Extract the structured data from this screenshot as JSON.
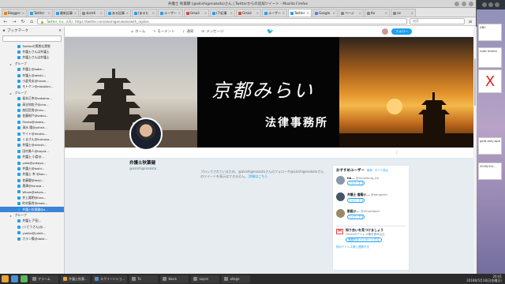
{
  "window": {
    "title": "弁護士 秋葉健 (@akishigenakoto)さん | Twitterからの追加ツイート - Mozilla Firefox"
  },
  "tabs": [
    {
      "label": "Blogger: ",
      "color": "#f57c00"
    },
    {
      "label": "Twitter",
      "color": "#1da1f2"
    },
    {
      "label": "最新記事",
      "color": "#1da1f2"
    },
    {
      "label": "本のHi",
      "color": "#888888"
    },
    {
      "label": "ある記事",
      "color": "#1da1f2"
    },
    {
      "label": "(あるた",
      "color": "#1da1f2"
    },
    {
      "label": "ユーザー",
      "color": "#1da1f2"
    },
    {
      "label": "Gmail",
      "color": "#d44638"
    },
    {
      "label": "(7)記事",
      "color": "#1da1f2"
    },
    {
      "label": "Gmail",
      "color": "#d44638"
    },
    {
      "label": "ユーザー",
      "color": "#1da1f2"
    },
    {
      "label": "Twitter",
      "color": "#1da1f2"
    },
    {
      "label": "Google",
      "color": "#4285f4"
    },
    {
      "label": "ページ",
      "color": "#888888"
    },
    {
      "label": "Ito",
      "color": "#888888"
    },
    {
      "label": "ne",
      "color": "#888888"
    }
  ],
  "navbar": {
    "back": "←",
    "forward": "→",
    "reload": "↻",
    "home": "⌂",
    "secure_label": "Twitter, Inc. (US)",
    "url": "https://twitter.com/akishigenakoto/with_replies",
    "search_placeholder": "検索"
  },
  "sidebar": {
    "title": "ブックマーク",
    "items": [
      {
        "label": "Twitterの実態な実態",
        "type": "bm",
        "indent": 14
      },
      {
        "label": "弁護士さんは弁護士",
        "type": "bm",
        "indent": 14
      },
      {
        "label": "弁護士さんは弁護士",
        "type": "bm",
        "indent": 14
      },
      {
        "label": "グループ",
        "type": "folder",
        "indent": 8
      },
      {
        "label": "弁護士@kabe...",
        "type": "bm",
        "indent": 14
      },
      {
        "label": "弁護士@akishi...",
        "type": "bm",
        "indent": 14
      },
      {
        "label": "小倉秀夫@hirom...",
        "type": "bm",
        "indent": 14
      },
      {
        "label": "モトケン@motoken...",
        "type": "bm",
        "indent": 14
      },
      {
        "label": "グループ",
        "type": "folder",
        "indent": 8
      },
      {
        "label": "坂本正幸@sakamo...",
        "type": "bm",
        "indent": 14
      },
      {
        "label": "高谷知佐子@cha...",
        "type": "bm",
        "indent": 14
      },
      {
        "label": "前田哲男@hiro...",
        "type": "bm",
        "indent": 14
      },
      {
        "label": "佐藤裕介@satou...",
        "type": "bm",
        "indent": 14
      },
      {
        "label": "Shoko@shoko...",
        "type": "bm",
        "indent": 14
      },
      {
        "label": "清水 陽@yohsh...",
        "type": "bm",
        "indent": 14
      },
      {
        "label": "サイト@hirokis...",
        "type": "bm",
        "indent": 14
      },
      {
        "label": "くまさん@kumasa...",
        "type": "bm",
        "indent": 14
      },
      {
        "label": "弁護士@shinsh...",
        "type": "bm",
        "indent": 14
      },
      {
        "label": "田村勇人@hayat...",
        "type": "bm",
        "indent": 14
      },
      {
        "label": "弁護士 小倉@...",
        "type": "bm",
        "indent": 14
      },
      {
        "label": "yoko@yokoya...",
        "type": "bm",
        "indent": 14
      },
      {
        "label": "弁護士@toshi...",
        "type": "bm",
        "indent": 14
      },
      {
        "label": "弁護士 幸 @kou...",
        "type": "bm",
        "indent": 14
      },
      {
        "label": "佐藤健@kenji...",
        "type": "bm",
        "indent": 14
      },
      {
        "label": "黒澤@kurosa...",
        "type": "bm",
        "indent": 14
      },
      {
        "label": "Whois@whois...",
        "type": "bm",
        "indent": 14
      },
      {
        "label": "井上陽明@hiro...",
        "type": "bm",
        "indent": 14
      },
      {
        "label": "町村泰貴@matc...",
        "type": "bm",
        "indent": 14
      },
      {
        "label": "弁護士秋葉健@a...",
        "type": "bm",
        "indent": 14,
        "selected": true
      },
      {
        "label": "グループ",
        "type": "folder",
        "indent": 8
      },
      {
        "label": "弁護士 戸田...",
        "type": "bm",
        "indent": 14
      },
      {
        "label": "(くどうさん)@...",
        "type": "bm",
        "indent": 14
      },
      {
        "label": "yukiko@yukik...",
        "type": "bm",
        "indent": 14
      },
      {
        "label": "カラン陽@daist...",
        "type": "bm",
        "indent": 14
      }
    ]
  },
  "twitter_nav": {
    "home": "ホーム",
    "moments": "モーメント",
    "notifications": "通知",
    "messages": "メッセージ",
    "follow_button": "フォロー"
  },
  "header": {
    "line1": "京都みらい",
    "line2": "法律事務所"
  },
  "profile": {
    "name": "弁護士秋葉健",
    "handle": "@akishigenakoto",
    "more": "⋮"
  },
  "blocked": {
    "message": "ブロックされているため、@akishigenakotoさんのフォローや@akishigenakotoさんのツイートを表示はできません。",
    "link": "詳細はこちら"
  },
  "recommended": {
    "title": "おすすめユーザー",
    "refresh": "更新",
    "all": "すべて見る",
    "users": [
      {
        "name": "Im...",
        "handle": "@reviewing_Ite",
        "button": "フォローする",
        "avatar_color": "#8899aa"
      },
      {
        "name": "弁護士 書籍@...",
        "handle": "@bengoshi",
        "button": "フォローする",
        "avatar_color": "#445566"
      },
      {
        "name": "動画@...",
        "handle": "@nihonbashi",
        "button": "フォローする",
        "avatar_color": "#998866"
      }
    ],
    "gmail_title": "知り合いを見つけましょう",
    "gmail_desc": "Gmailのアドレス帳を読み込む",
    "gmail_link": "連絡先をインポートする",
    "more_link": "他のアドレス帳と連携する"
  },
  "stickies": [
    {
      "text": "ABC"
    },
    {
      "text": "note memo"
    },
    {
      "text": "X"
    },
    {
      "text": "gold-stay-apk"
    },
    {
      "text": "2018/10/..."
    }
  ],
  "taskbar": {
    "apps": [
      {
        "label": "",
        "color": "#e8a33c"
      },
      {
        "label": "",
        "color": "#4a90d9"
      },
      {
        "label": "",
        "color": "#5cb85c"
      },
      {
        "label": "アラーム",
        "color": "#888888"
      },
      {
        "label": "弁護士秋葉...",
        "color": "#e8a33c"
      },
      {
        "label": "スクリーンショ...",
        "color": "#4a90d9"
      },
      {
        "label": "To",
        "color": "#888888"
      },
      {
        "label": "block",
        "color": "#888888"
      },
      {
        "label": "sayes",
        "color": "#888888"
      },
      {
        "label": "allege",
        "color": "#888888"
      }
    ],
    "time": "20:41",
    "date": "2018年5月18日(金曜日)"
  }
}
